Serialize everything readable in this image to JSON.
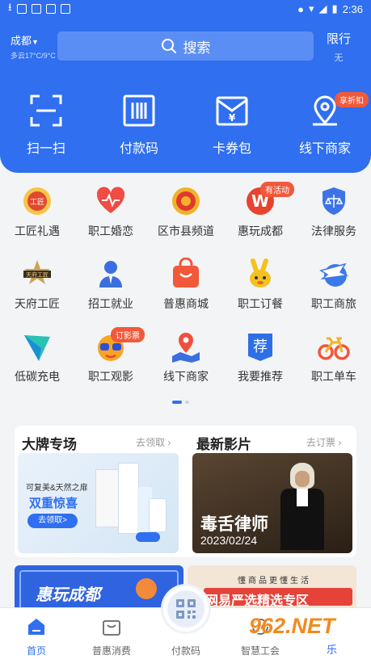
{
  "status_bar": {
    "time": "2:36"
  },
  "header": {
    "city": "成都",
    "weather": "多云17°C/9°C",
    "search_label": "搜索",
    "limit_label": "限行",
    "limit_value": "无",
    "accent_color": "#2f6ff0"
  },
  "quick_actions": [
    {
      "label": "扫一扫",
      "icon": "scan-icon"
    },
    {
      "label": "付款码",
      "icon": "barcode-icon"
    },
    {
      "label": "卡券包",
      "icon": "coupon-wallet-icon"
    },
    {
      "label": "线下商家",
      "icon": "location-pin-icon",
      "badge": "享折扣"
    }
  ],
  "services": [
    {
      "label": "工匠礼遇",
      "icon": "craftsman-medal-icon"
    },
    {
      "label": "职工婚恋",
      "icon": "heart-icon"
    },
    {
      "label": "区市县频道",
      "icon": "union-emblem-icon"
    },
    {
      "label": "惠玩成都",
      "icon": "huiwan-logo-icon",
      "badge": "有活动"
    },
    {
      "label": "法律服务",
      "icon": "law-shield-icon"
    },
    {
      "label": "天府工匠",
      "icon": "tianfu-craftsman-logo-icon"
    },
    {
      "label": "招工就业",
      "icon": "recruit-person-icon"
    },
    {
      "label": "普惠商城",
      "icon": "shopping-bag-icon"
    },
    {
      "label": "职工订餐",
      "icon": "meal-mascot-icon"
    },
    {
      "label": "职工商旅",
      "icon": "travel-plane-icon"
    },
    {
      "label": "低碳充电",
      "icon": "charging-bolt-icon"
    },
    {
      "label": "职工观影",
      "icon": "movie-mascot-icon",
      "badge": "订影票"
    },
    {
      "label": "线下商家",
      "icon": "map-location-icon"
    },
    {
      "label": "我要推荐",
      "icon": "recommend-icon",
      "glyph": "荐"
    },
    {
      "label": "职工单车",
      "icon": "bicycle-icon"
    }
  ],
  "promo": {
    "left_title": "大牌专场",
    "left_more": "去领取",
    "left_banner": {
      "line1": "可复美&天然之扉",
      "line2": "双重惊喜",
      "button": "去领取>"
    },
    "right_title": "最新影片",
    "right_more": "去订票",
    "right_banner": {
      "movie": "毒舌律师",
      "date": "2023/02/24"
    }
  },
  "bottom_banners": {
    "left": "惠玩成都",
    "right_top": "懂商品更懂生活",
    "right_main": "网易严选精选专区"
  },
  "tabbar": [
    {
      "label": "首页",
      "icon": "home-icon",
      "active": true
    },
    {
      "label": "普惠消费",
      "icon": "shopping-bag-icon"
    },
    {
      "label": "付款码",
      "icon": "qr-code-icon"
    },
    {
      "label": "智慧工会",
      "icon": "smart-union-icon"
    }
  ],
  "watermark": {
    "text": "962.NET",
    "subtext": "乐游网"
  }
}
